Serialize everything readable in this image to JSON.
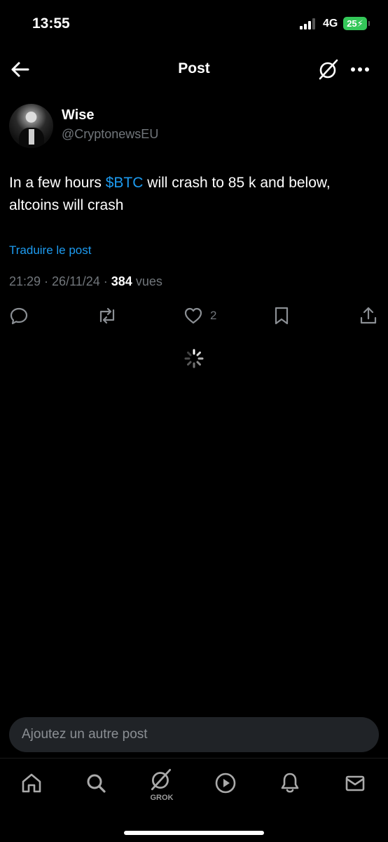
{
  "status_bar": {
    "time": "13:55",
    "network": "4G",
    "battery": "25"
  },
  "header": {
    "title": "Post",
    "back_icon": "arrow-left-icon",
    "grok_icon": "grok-icon",
    "more_icon": "more-horizontal-icon"
  },
  "post": {
    "author_name": "Wise",
    "author_handle": "@CryptonewsEU",
    "text_before": "In a few hours ",
    "cashtag": "$BTC",
    "text_after": " will crash to 85 k and below, altcoins will crash",
    "translate": "Traduire le post",
    "time": "21:29",
    "date": "26/11/24",
    "views_count": "384",
    "views_label": "vues",
    "likes": "2"
  },
  "reply": {
    "placeholder": "Ajoutez un autre post"
  },
  "tab_bar": {
    "grok_label": "GROK"
  },
  "colors": {
    "background": "#000000",
    "accent": "#1d9bf0",
    "muted": "#71767b",
    "battery": "#34c759"
  }
}
